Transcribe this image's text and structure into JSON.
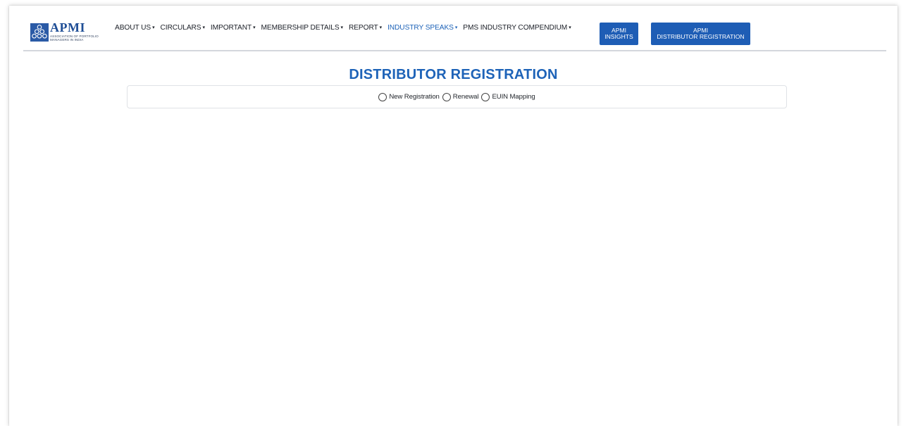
{
  "logo": {
    "wordmark": "APMI",
    "subtitle": "Association of Portfolio Managers in India"
  },
  "nav": {
    "items": [
      {
        "label": "ABOUT US",
        "caret": "▾",
        "active": false
      },
      {
        "label": "CIRCULARS",
        "caret": "▾",
        "active": false
      },
      {
        "label": "IMPORTANT",
        "caret": "▾",
        "active": false
      },
      {
        "label": "MEMBERSHIP DETAILS",
        "caret": "▾",
        "active": false
      },
      {
        "label": "REPORT",
        "caret": "▾",
        "active": false
      },
      {
        "label": "INDUSTRY SPEAKS",
        "caret": "▾",
        "active": true
      },
      {
        "label": "PMS INDUSTRY COMPENDIUM",
        "caret": "▾",
        "active": false
      }
    ]
  },
  "buttons": {
    "insights_line1": "APMI",
    "insights_line2": "INSIGHTS",
    "distributor_line1": "APMI",
    "distributor_line2": "DISTRIBUTOR REGISTRATION"
  },
  "page": {
    "title": "DISTRIBUTOR REGISTRATION"
  },
  "registration_type": {
    "options": [
      "New Registration",
      "Renewal",
      "EUIN Mapping"
    ],
    "selected": null
  },
  "colors": {
    "brand_blue": "#1e63b8",
    "button_blue": "#1e5db5",
    "divider": "#d4d7dc"
  },
  "icons": {
    "logo_mark": "apmi-triangle-logo-icon"
  }
}
